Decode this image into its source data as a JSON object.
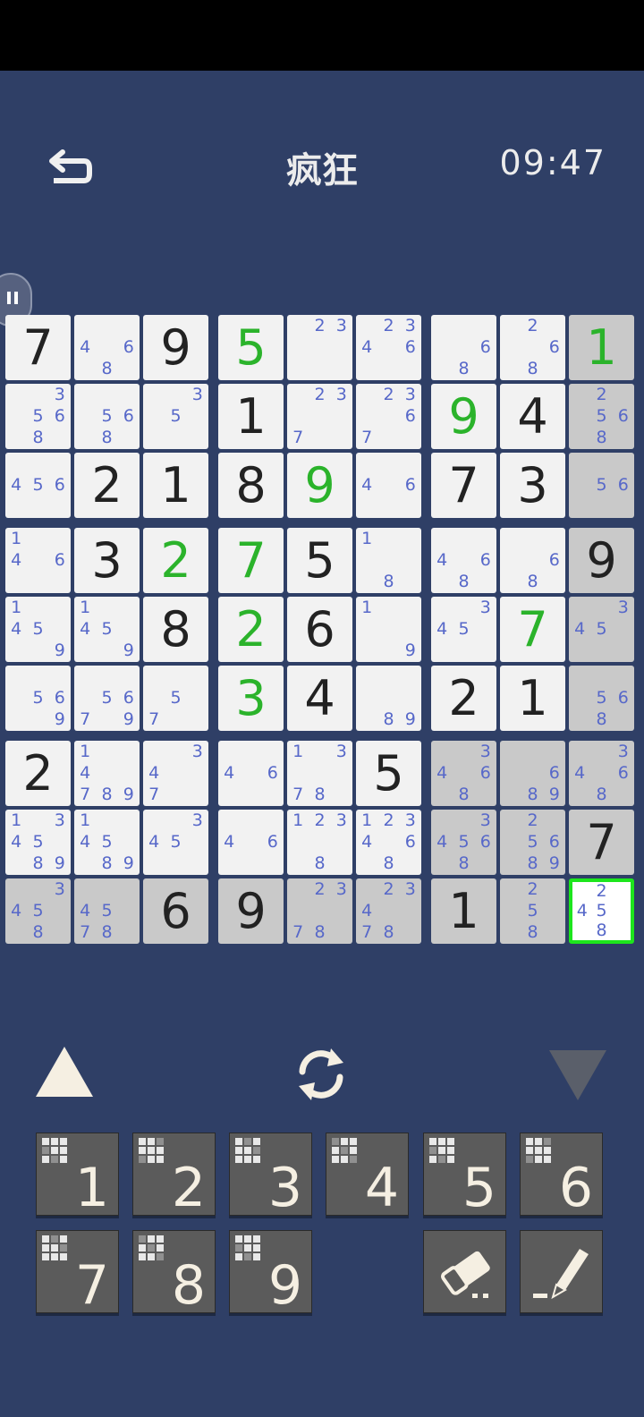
{
  "header": {
    "title": "疯狂",
    "timer": "09:47"
  },
  "board": {
    "cells": [
      [
        {
          "v": "7"
        },
        {
          "n": [
            "4",
            "6",
            "8"
          ]
        },
        {
          "v": "9"
        },
        {
          "v": "5",
          "g": true
        },
        {
          "n": [
            "2",
            "3"
          ]
        },
        {
          "n": [
            "2",
            "3",
            "4",
            "6"
          ]
        },
        {
          "n": [
            "6",
            "8"
          ]
        },
        {
          "n": [
            "2",
            "6",
            "8"
          ]
        },
        {
          "v": "1",
          "g": true,
          "s": true
        }
      ],
      [
        {
          "n": [
            "3",
            "5",
            "6",
            "8"
          ]
        },
        {
          "n": [
            "5",
            "6",
            "8"
          ]
        },
        {
          "n": [
            "3",
            "5"
          ]
        },
        {
          "v": "1"
        },
        {
          "n": [
            "2",
            "3",
            "7"
          ]
        },
        {
          "n": [
            "2",
            "3",
            "6",
            "7"
          ]
        },
        {
          "v": "9",
          "g": true
        },
        {
          "v": "4"
        },
        {
          "n": [
            "2",
            "5",
            "6",
            "8"
          ],
          "s": true
        }
      ],
      [
        {
          "n": [
            "4",
            "5",
            "6"
          ]
        },
        {
          "v": "2"
        },
        {
          "v": "1"
        },
        {
          "v": "8"
        },
        {
          "v": "9",
          "g": true
        },
        {
          "n": [
            "4",
            "6"
          ]
        },
        {
          "v": "7"
        },
        {
          "v": "3"
        },
        {
          "n": [
            "5",
            "6"
          ],
          "s": true
        }
      ],
      [
        {
          "n": [
            "1",
            "4",
            "6"
          ]
        },
        {
          "v": "3"
        },
        {
          "v": "2",
          "g": true
        },
        {
          "v": "7",
          "g": true
        },
        {
          "v": "5"
        },
        {
          "n": [
            "1",
            "8"
          ]
        },
        {
          "n": [
            "4",
            "6",
            "8"
          ]
        },
        {
          "n": [
            "6",
            "8"
          ]
        },
        {
          "v": "9",
          "s": true
        }
      ],
      [
        {
          "n": [
            "1",
            "4",
            "5",
            "9"
          ]
        },
        {
          "n": [
            "1",
            "4",
            "5",
            "9"
          ]
        },
        {
          "v": "8"
        },
        {
          "v": "2",
          "g": true
        },
        {
          "v": "6"
        },
        {
          "n": [
            "1",
            "9"
          ]
        },
        {
          "n": [
            "3",
            "4",
            "5"
          ]
        },
        {
          "v": "7",
          "g": true
        },
        {
          "n": [
            "3",
            "4",
            "5"
          ],
          "s": true
        }
      ],
      [
        {
          "n": [
            "5",
            "6",
            "9"
          ]
        },
        {
          "n": [
            "5",
            "6",
            "7",
            "9"
          ]
        },
        {
          "n": [
            "5",
            "7"
          ]
        },
        {
          "v": "3",
          "g": true
        },
        {
          "v": "4"
        },
        {
          "n": [
            "8",
            "9"
          ]
        },
        {
          "v": "2"
        },
        {
          "v": "1"
        },
        {
          "n": [
            "5",
            "6",
            "8"
          ],
          "s": true
        }
      ],
      [
        {
          "v": "2"
        },
        {
          "n": [
            "1",
            "4",
            "7",
            "8",
            "9"
          ]
        },
        {
          "n": [
            "3",
            "4",
            "7"
          ]
        },
        {
          "n": [
            "4",
            "6"
          ]
        },
        {
          "n": [
            "1",
            "3",
            "7",
            "8"
          ]
        },
        {
          "v": "5"
        },
        {
          "n": [
            "3",
            "4",
            "6",
            "8"
          ],
          "s": true
        },
        {
          "n": [
            "6",
            "8",
            "9"
          ],
          "s": true
        },
        {
          "n": [
            "3",
            "4",
            "6",
            "8"
          ],
          "s": true
        }
      ],
      [
        {
          "n": [
            "1",
            "3",
            "4",
            "5",
            "8",
            "9"
          ]
        },
        {
          "n": [
            "1",
            "4",
            "5",
            "8",
            "9"
          ]
        },
        {
          "n": [
            "3",
            "4",
            "5"
          ]
        },
        {
          "n": [
            "4",
            "6"
          ]
        },
        {
          "n": [
            "1",
            "2",
            "3",
            "8"
          ]
        },
        {
          "n": [
            "1",
            "2",
            "3",
            "4",
            "6",
            "8"
          ]
        },
        {
          "n": [
            "3",
            "4",
            "5",
            "6",
            "8"
          ],
          "s": true
        },
        {
          "n": [
            "2",
            "5",
            "6",
            "8",
            "9"
          ],
          "s": true
        },
        {
          "v": "7",
          "s": true
        }
      ],
      [
        {
          "n": [
            "3",
            "4",
            "5",
            "8"
          ],
          "s": true
        },
        {
          "n": [
            "4",
            "5",
            "7",
            "8"
          ],
          "s": true
        },
        {
          "v": "6",
          "s": true
        },
        {
          "v": "9",
          "s": true
        },
        {
          "n": [
            "2",
            "3",
            "7",
            "8"
          ],
          "s": true
        },
        {
          "n": [
            "2",
            "3",
            "4",
            "7",
            "8"
          ],
          "s": true
        },
        {
          "v": "1",
          "s": true
        },
        {
          "n": [
            "2",
            "5",
            "8"
          ],
          "s": true
        },
        {
          "n": [
            "2",
            "4",
            "5",
            "8"
          ],
          "sel": true
        }
      ]
    ]
  },
  "keypad": {
    "digits": [
      "1",
      "2",
      "3",
      "4",
      "5",
      "6",
      "7",
      "8",
      "9"
    ]
  },
  "colors": {
    "background": "#2f3f66",
    "given_digit": "#222222",
    "entered_digit": "#2bb32b",
    "note": "#5768c9",
    "selection": "#1de61d"
  },
  "icons": [
    "undo-icon",
    "pause-icon",
    "arrow-up-icon",
    "refresh-icon",
    "arrow-down-icon",
    "eraser-icon",
    "pencil-icon"
  ]
}
